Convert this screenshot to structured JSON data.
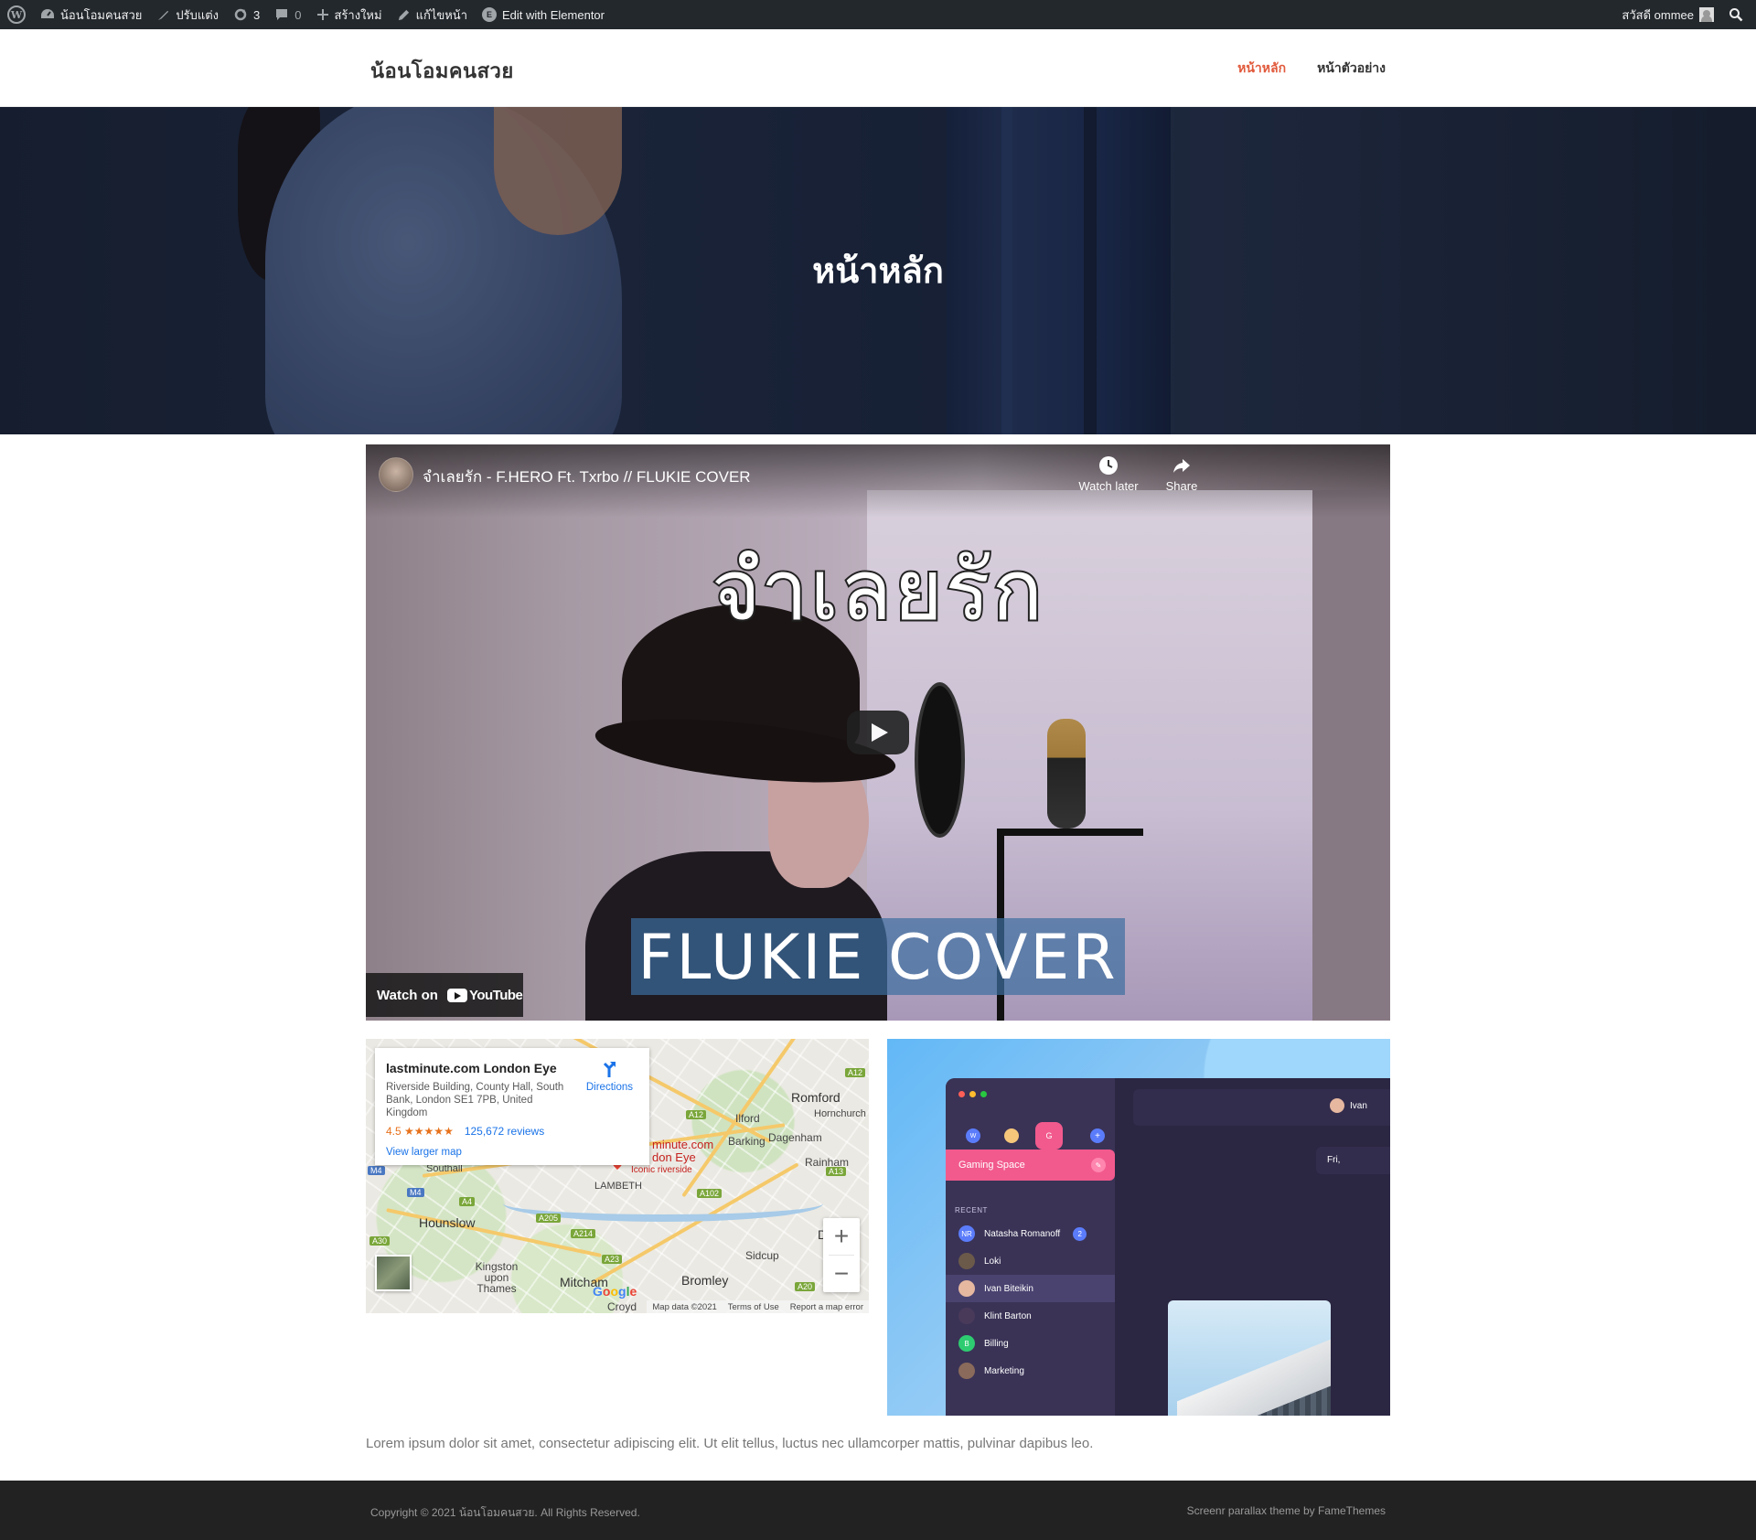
{
  "admin_bar": {
    "site_name": "น้อนโอมคนสวย",
    "customize": "ปรับแต่ง",
    "updates_count": "3",
    "comments_count": "0",
    "new": "สร้างใหม่",
    "edit_page": "แก้ไขหน้า",
    "elementor": "Edit with Elementor",
    "greeting": "สวัสดี ommee"
  },
  "header": {
    "site_title": "น้อนโอมคนสวย",
    "nav": [
      {
        "label": "หน้าหลัก",
        "active": true
      },
      {
        "label": "หน้าตัวอย่าง",
        "active": false
      }
    ],
    "accent_color": "#e15a3c"
  },
  "hero": {
    "title": "หน้าหลัก"
  },
  "video": {
    "title": "จำเลยรัก - F.HERO Ft. Txrbo // FLUKIE COVER",
    "watch_later": "Watch later",
    "share": "Share",
    "overlay_title": "จำเลยรัก",
    "overlay_subtitle": "FLUKIE COVER",
    "watch_on": "Watch on",
    "youtube": "YouTube"
  },
  "map": {
    "place_name": "lastminute.com London Eye",
    "address": "Riverside Building, County Hall, South Bank, London SE1 7PB, United Kingdom",
    "rating": "4.5",
    "stars": "★★★★★",
    "reviews": "125,672 reviews",
    "directions": "Directions",
    "view_larger": "View larger map",
    "labels": {
      "romford": "Romford",
      "hornchurch": "Hornchurch",
      "ilford": "Ilford",
      "barking": "Barking",
      "dagenham": "Dagenham",
      "rainham": "Rainham",
      "southall": "Southall",
      "lambeth": "LAMBETH",
      "hounslow": "Hounslow",
      "kingston": "Kingston upon Thames",
      "mitcham": "Mitcham",
      "croydon": "Croyd",
      "bromley": "Bromley",
      "sidcup": "Sidcup",
      "dartford": "D",
      "pin_name_1": "minute.com",
      "pin_name_2": "don Eye",
      "pin_sub": "Iconic riverside",
      "shields": [
        "A12",
        "A12",
        "M4",
        "A4",
        "A205",
        "A214",
        "A23",
        "A30",
        "A102",
        "A13",
        "A20"
      ]
    },
    "footer": {
      "data": "Map data ©2021",
      "terms": "Terms of Use",
      "report": "Report a map error"
    },
    "zoom_in": "+",
    "zoom_out": "−",
    "google_letters": [
      "G",
      "o",
      "o",
      "g",
      "l",
      "e"
    ]
  },
  "mockup": {
    "workspace_icons": [
      "W",
      "",
      "G",
      "+"
    ],
    "active_space": "Gaming Space",
    "recent_label": "RECENT",
    "contacts": [
      {
        "name": "Natasha Romanoff",
        "initials": "NR",
        "badge": "2",
        "color": "#5b7cfa"
      },
      {
        "name": "Loki",
        "initials": "",
        "badge": "",
        "color": "#6b5a4a"
      },
      {
        "name": "Ivan Biteikin",
        "initials": "",
        "badge": "",
        "color": "#e6b8a0",
        "selected": true
      },
      {
        "name": "Klint Barton",
        "initials": "",
        "badge": "",
        "color": "#4a3a5a"
      },
      {
        "name": "Billing",
        "initials": "B",
        "badge": "",
        "color": "#2ecc71"
      },
      {
        "name": "Marketing",
        "initials": "",
        "badge": "",
        "color": "#8a6a5a"
      }
    ],
    "chat_user": "Ivan",
    "chat_day": "Fri,"
  },
  "content": {
    "paragraph": "Lorem ipsum dolor sit amet, consectetur adipiscing elit. Ut elit tellus, luctus nec ullamcorper mattis, pulvinar dapibus leo."
  },
  "footer": {
    "copyright": "Copyright © 2021 น้อนโอมคนสวย. All Rights Reserved.",
    "credit": "Screenr parallax theme by FameThemes"
  }
}
